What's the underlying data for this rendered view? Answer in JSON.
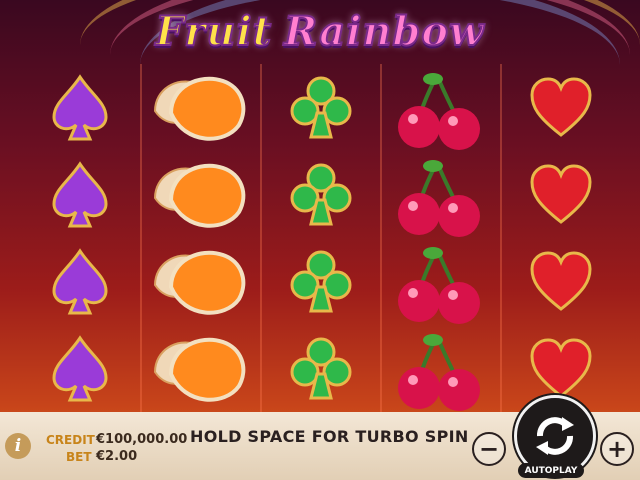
{
  "game": {
    "title_word1": "Fruit",
    "title_word2": "Rainbow"
  },
  "reels": [
    {
      "symbol": "purple-spade"
    },
    {
      "symbol": "orange-slices"
    },
    {
      "symbol": "green-club"
    },
    {
      "symbol": "cherries"
    },
    {
      "symbol": "red-heart"
    }
  ],
  "rows_visible": 4,
  "bottom_bar": {
    "info_label": "i",
    "credit_label": "CREDIT",
    "credit_value": "€100,000.00",
    "bet_label": "BET",
    "bet_value": "€2.00",
    "message": "HOLD SPACE FOR TURBO SPIN",
    "minus_label": "−",
    "plus_label": "+",
    "autoplay_label": "AUTOPLAY"
  },
  "colors": {
    "spade": "#9a3bd8",
    "club": "#2fb84a",
    "heart": "#e0202a",
    "cherry": "#d8124a",
    "orange": "#ff8a1e",
    "gold_border": "#e8b84a"
  }
}
